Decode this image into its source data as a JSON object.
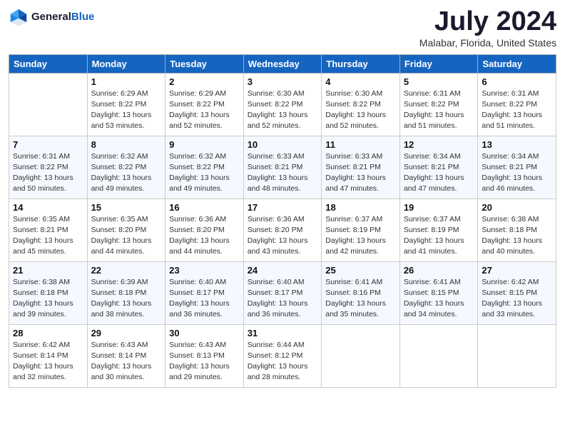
{
  "header": {
    "logo_general": "General",
    "logo_blue": "Blue",
    "month_year": "July 2024",
    "location": "Malabar, Florida, United States"
  },
  "weekdays": [
    "Sunday",
    "Monday",
    "Tuesday",
    "Wednesday",
    "Thursday",
    "Friday",
    "Saturday"
  ],
  "weeks": [
    [
      {
        "day": "",
        "info": ""
      },
      {
        "day": "1",
        "info": "Sunrise: 6:29 AM\nSunset: 8:22 PM\nDaylight: 13 hours\nand 53 minutes."
      },
      {
        "day": "2",
        "info": "Sunrise: 6:29 AM\nSunset: 8:22 PM\nDaylight: 13 hours\nand 52 minutes."
      },
      {
        "day": "3",
        "info": "Sunrise: 6:30 AM\nSunset: 8:22 PM\nDaylight: 13 hours\nand 52 minutes."
      },
      {
        "day": "4",
        "info": "Sunrise: 6:30 AM\nSunset: 8:22 PM\nDaylight: 13 hours\nand 52 minutes."
      },
      {
        "day": "5",
        "info": "Sunrise: 6:31 AM\nSunset: 8:22 PM\nDaylight: 13 hours\nand 51 minutes."
      },
      {
        "day": "6",
        "info": "Sunrise: 6:31 AM\nSunset: 8:22 PM\nDaylight: 13 hours\nand 51 minutes."
      }
    ],
    [
      {
        "day": "7",
        "info": "Sunrise: 6:31 AM\nSunset: 8:22 PM\nDaylight: 13 hours\nand 50 minutes."
      },
      {
        "day": "8",
        "info": "Sunrise: 6:32 AM\nSunset: 8:22 PM\nDaylight: 13 hours\nand 49 minutes."
      },
      {
        "day": "9",
        "info": "Sunrise: 6:32 AM\nSunset: 8:22 PM\nDaylight: 13 hours\nand 49 minutes."
      },
      {
        "day": "10",
        "info": "Sunrise: 6:33 AM\nSunset: 8:21 PM\nDaylight: 13 hours\nand 48 minutes."
      },
      {
        "day": "11",
        "info": "Sunrise: 6:33 AM\nSunset: 8:21 PM\nDaylight: 13 hours\nand 47 minutes."
      },
      {
        "day": "12",
        "info": "Sunrise: 6:34 AM\nSunset: 8:21 PM\nDaylight: 13 hours\nand 47 minutes."
      },
      {
        "day": "13",
        "info": "Sunrise: 6:34 AM\nSunset: 8:21 PM\nDaylight: 13 hours\nand 46 minutes."
      }
    ],
    [
      {
        "day": "14",
        "info": "Sunrise: 6:35 AM\nSunset: 8:21 PM\nDaylight: 13 hours\nand 45 minutes."
      },
      {
        "day": "15",
        "info": "Sunrise: 6:35 AM\nSunset: 8:20 PM\nDaylight: 13 hours\nand 44 minutes."
      },
      {
        "day": "16",
        "info": "Sunrise: 6:36 AM\nSunset: 8:20 PM\nDaylight: 13 hours\nand 44 minutes."
      },
      {
        "day": "17",
        "info": "Sunrise: 6:36 AM\nSunset: 8:20 PM\nDaylight: 13 hours\nand 43 minutes."
      },
      {
        "day": "18",
        "info": "Sunrise: 6:37 AM\nSunset: 8:19 PM\nDaylight: 13 hours\nand 42 minutes."
      },
      {
        "day": "19",
        "info": "Sunrise: 6:37 AM\nSunset: 8:19 PM\nDaylight: 13 hours\nand 41 minutes."
      },
      {
        "day": "20",
        "info": "Sunrise: 6:38 AM\nSunset: 8:18 PM\nDaylight: 13 hours\nand 40 minutes."
      }
    ],
    [
      {
        "day": "21",
        "info": "Sunrise: 6:38 AM\nSunset: 8:18 PM\nDaylight: 13 hours\nand 39 minutes."
      },
      {
        "day": "22",
        "info": "Sunrise: 6:39 AM\nSunset: 8:18 PM\nDaylight: 13 hours\nand 38 minutes."
      },
      {
        "day": "23",
        "info": "Sunrise: 6:40 AM\nSunset: 8:17 PM\nDaylight: 13 hours\nand 36 minutes."
      },
      {
        "day": "24",
        "info": "Sunrise: 6:40 AM\nSunset: 8:17 PM\nDaylight: 13 hours\nand 36 minutes."
      },
      {
        "day": "25",
        "info": "Sunrise: 6:41 AM\nSunset: 8:16 PM\nDaylight: 13 hours\nand 35 minutes."
      },
      {
        "day": "26",
        "info": "Sunrise: 6:41 AM\nSunset: 8:15 PM\nDaylight: 13 hours\nand 34 minutes."
      },
      {
        "day": "27",
        "info": "Sunrise: 6:42 AM\nSunset: 8:15 PM\nDaylight: 13 hours\nand 33 minutes."
      }
    ],
    [
      {
        "day": "28",
        "info": "Sunrise: 6:42 AM\nSunset: 8:14 PM\nDaylight: 13 hours\nand 32 minutes."
      },
      {
        "day": "29",
        "info": "Sunrise: 6:43 AM\nSunset: 8:14 PM\nDaylight: 13 hours\nand 30 minutes."
      },
      {
        "day": "30",
        "info": "Sunrise: 6:43 AM\nSunset: 8:13 PM\nDaylight: 13 hours\nand 29 minutes."
      },
      {
        "day": "31",
        "info": "Sunrise: 6:44 AM\nSunset: 8:12 PM\nDaylight: 13 hours\nand 28 minutes."
      },
      {
        "day": "",
        "info": ""
      },
      {
        "day": "",
        "info": ""
      },
      {
        "day": "",
        "info": ""
      }
    ]
  ]
}
